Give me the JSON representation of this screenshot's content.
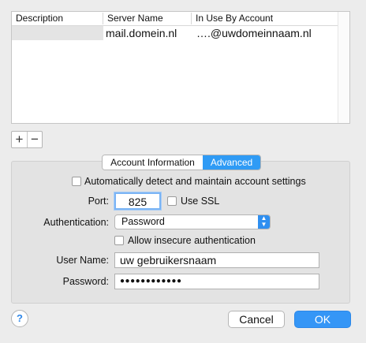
{
  "table": {
    "headers": [
      "Description",
      "Server Name",
      "In Use By Account"
    ],
    "rows": [
      {
        "description": "",
        "server_name": "mail.domein.nl",
        "account": "….@uwdomeinnaam.nl"
      }
    ]
  },
  "list_controls": {
    "add": "+",
    "remove": "−"
  },
  "tabs": [
    {
      "label": "Account Information",
      "selected": false
    },
    {
      "label": "Advanced",
      "selected": true
    }
  ],
  "advanced": {
    "auto_detect_label": "Automatically detect and maintain account settings",
    "auto_detect_checked": false,
    "port_label": "Port:",
    "port_value": "825",
    "use_ssl_label": "Use SSL",
    "use_ssl_checked": false,
    "auth_label": "Authentication:",
    "auth_value": "Password",
    "allow_insecure_label": "Allow insecure authentication",
    "allow_insecure_checked": false,
    "username_label": "User Name:",
    "username_value": "uw gebruikersnaam",
    "password_label": "Password:",
    "password_value": "●●●●●●●●●●●●"
  },
  "footer": {
    "help": "?",
    "cancel_label": "Cancel",
    "ok_label": "OK"
  },
  "colors": {
    "accent": "#2f9bf5",
    "window_bg": "#ececec",
    "panel_bg": "#e3e3e3"
  },
  "icons": {
    "help": "question-mark-icon",
    "select_arrows": "up-down-chevron-icon"
  }
}
